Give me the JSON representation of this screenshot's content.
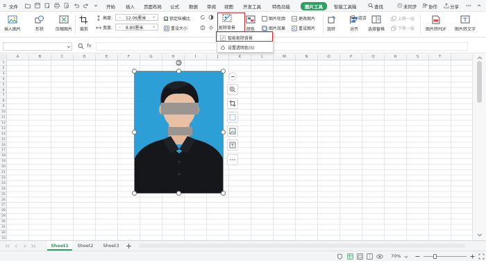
{
  "menubar": {
    "hamburger_label": "≡",
    "file_label": "文件",
    "tabs": [
      "开始",
      "插入",
      "页面布局",
      "公式",
      "数据",
      "审阅",
      "视图",
      "开发工具",
      "特色功能",
      "图片工具",
      "智能工具箱"
    ],
    "active_tab_index": 9,
    "search_label": "查找",
    "sync_label": "未同步",
    "collab_label": "协作",
    "share_label": "分享"
  },
  "ribbon": {
    "insert_picture": "插入图片",
    "shape": "形状",
    "compress": "压缩图片",
    "crop": "裁剪",
    "height_label": "高度:",
    "height_value": "12.06厘米",
    "width_label": "宽度:",
    "width_value": "8.80厘米",
    "lock_ratio": "锁定纵横比",
    "reset_size": "重设大小",
    "remove_bg": "抠除背景",
    "color": "颜色",
    "outline": "图片轮廓",
    "effect": "图片效果",
    "change_picture": "更改图片",
    "reset_picture": "重设图片",
    "rotate": "旋转",
    "align": "对齐",
    "group": "组合",
    "bring_forward": "上移一层",
    "send_backward": "下移一层",
    "selection_pane": "选择窗格",
    "to_pdf": "图片转PDF",
    "to_text": "图片转文字"
  },
  "dropdown": {
    "items": [
      "智能抠除背景",
      "设置透明色(S)"
    ]
  },
  "formula_bar": {
    "fx": "fx",
    "name_value": ""
  },
  "columns": [
    "A",
    "B",
    "C",
    "D",
    "E",
    "F",
    "G",
    "H",
    "I",
    "J",
    "K",
    "L",
    "M",
    "N",
    "O",
    "P",
    "Q",
    "R",
    "S",
    "T"
  ],
  "rows": [
    "1",
    "2",
    "3",
    "4",
    "5",
    "6",
    "7",
    "8",
    "9",
    "10",
    "11",
    "12",
    "13",
    "14",
    "15",
    "16",
    "17",
    "18",
    "19",
    "20",
    "21",
    "22",
    "23",
    "24",
    "25",
    "26",
    "27",
    "28",
    "29",
    "30",
    "31",
    "32",
    "33"
  ],
  "sheets": [
    "Sheet1",
    "Sheet2",
    "Sheet3"
  ],
  "active_sheet_index": 0,
  "status": {
    "zoom": "70%"
  },
  "colors": {
    "accent": "#2f9e63",
    "photo_bg": "#2b9fd6",
    "highlight": "#d9262c"
  }
}
